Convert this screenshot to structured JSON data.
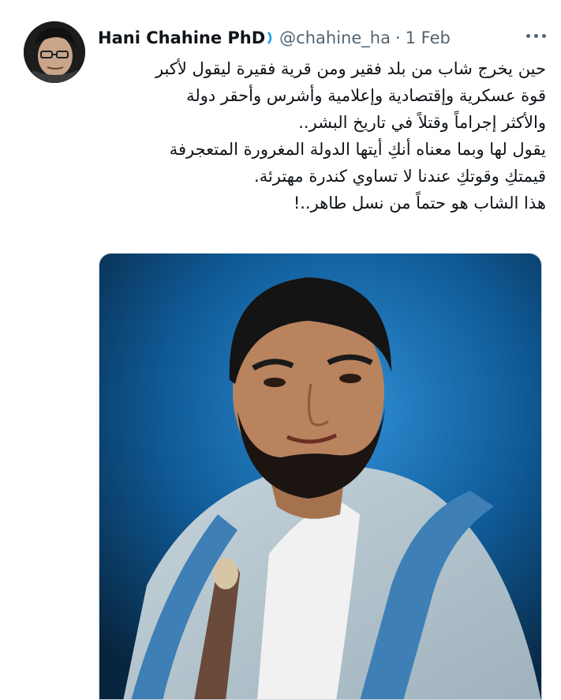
{
  "tweet": {
    "author_name": "Hani Chahine PhD",
    "handle": "@chahine_ha",
    "separator": "·",
    "date": "1 Feb",
    "lines": [
      "حين يخرج شاب من بلد فقير ومن قرية فقيرة ليقول لأكبر",
      "قوة عسكرية وإقتصادية وإعلامية وأشرس وأحقر دولة",
      "والأكثر إجراماً وقتلاً في تاريخ البشر..",
      "يقول لها وبما معناه أنكِ أيتها الدولة المغرورة المتعجرفة",
      "قيمتكِ وقوتكِ عندنا لا تساوي كندرة مهترئة.",
      "هذا الشاب هو حتماً من نسل طاهر..!"
    ]
  },
  "icons": {
    "more": "more-horizontal-icon",
    "badge": "verified-badge-icon"
  },
  "colors": {
    "text_primary": "#0f1419",
    "text_secondary": "#536471",
    "border": "#cfd9de",
    "media_bg": "#0d4f86"
  }
}
